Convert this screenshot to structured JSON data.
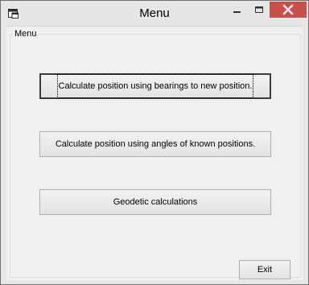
{
  "window": {
    "title": "Menu",
    "icon": "app-window-icon",
    "controls": {
      "minimize_icon": "minimize-icon",
      "maximize_icon": "maximize-icon",
      "close_icon": "close-icon",
      "close_color": "#c7504b"
    }
  },
  "group": {
    "label": "Menu"
  },
  "buttons": {
    "bearings_label": "Calculate position using bearings to new position.",
    "angles_label": "Calculate position using angles of known positions.",
    "geodetic_label": "Geodetic calculations",
    "exit_label": "Exit"
  }
}
